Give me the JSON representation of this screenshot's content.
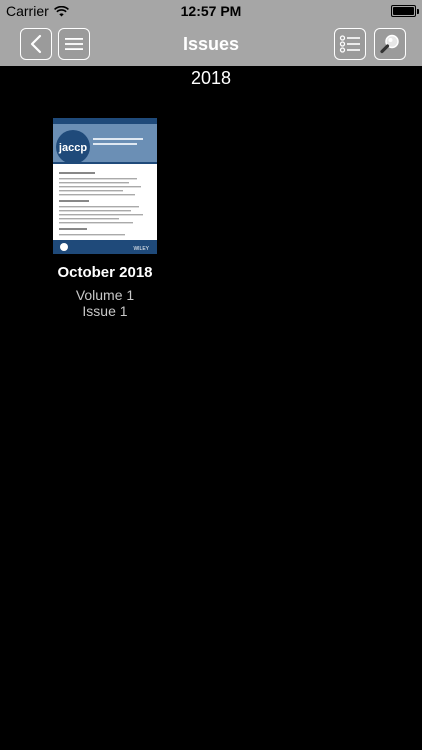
{
  "status_bar": {
    "carrier": "Carrier",
    "time": "12:57 PM",
    "battery_level": 1.0
  },
  "nav_bar": {
    "title": "Issues",
    "left_buttons": [
      "back-icon",
      "menu-icon"
    ],
    "right_buttons": [
      "list-icon",
      "search-icon"
    ]
  },
  "sections": [
    {
      "year": "2018",
      "issues": [
        {
          "date": "October 2018",
          "volume": "Volume 1",
          "issue": "Issue 1",
          "cover_logo": "jaccp",
          "cover_publisher": "WILEY"
        }
      ]
    }
  ],
  "colors": {
    "nav_background": "#a6a6a6",
    "background": "#000000",
    "cover_blue": "#1f4a7a"
  }
}
